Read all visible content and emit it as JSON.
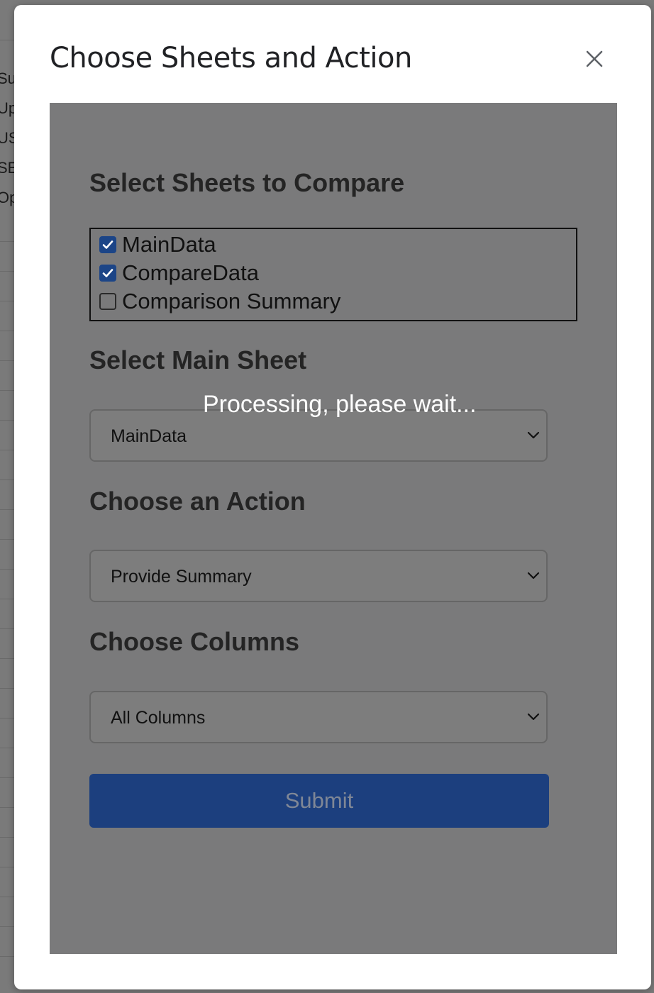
{
  "background": {
    "cell_fragments": [
      "Su",
      "Up",
      "US",
      "SE",
      "Op"
    ]
  },
  "dialog": {
    "title": "Choose Sheets and Action",
    "close_icon": "close-icon"
  },
  "form": {
    "sheets_heading": "Select Sheets to Compare",
    "sheets": [
      {
        "label": "MainData",
        "checked": true
      },
      {
        "label": "CompareData",
        "checked": true
      },
      {
        "label": "Comparison Summary",
        "checked": false
      }
    ],
    "main_sheet_heading": "Select Main Sheet",
    "main_sheet_value": "MainData",
    "action_heading": "Choose an Action",
    "action_value": "Provide Summary",
    "columns_heading": "Choose Columns",
    "columns_value": "All Columns",
    "submit_label": "Submit"
  },
  "overlay": {
    "processing_text": "Processing, please wait..."
  },
  "colors": {
    "accent": "#1c4587",
    "submit_bg": "#1c3f7e",
    "overlay_bg": "#7a7a7b"
  }
}
